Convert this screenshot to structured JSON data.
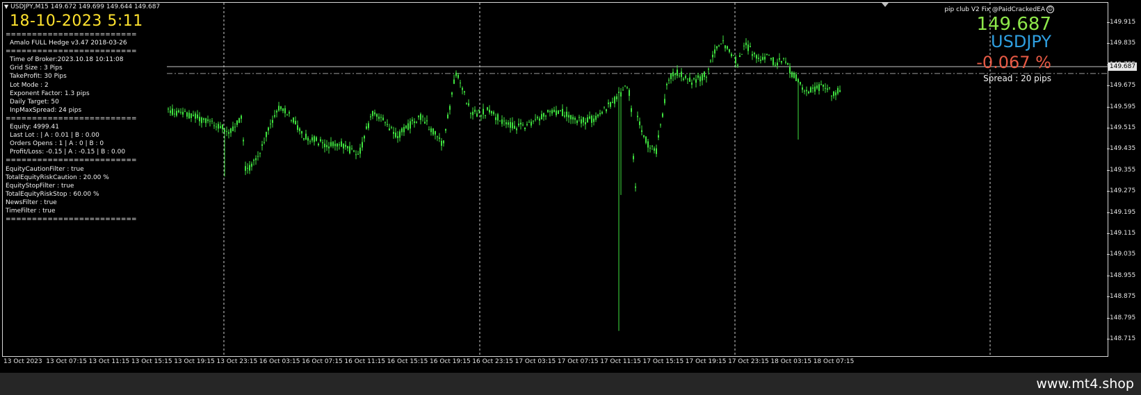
{
  "window": {
    "symbol_timeframe": "USDJPY,M15",
    "ohlc": "149.672 149.699 149.644 149.687",
    "header_text": "USDJPY,M15  149.672 149.699 149.644 149.687"
  },
  "overlay": {
    "big_date": "18-10-2023 5:11",
    "brand": "pip club V2 Fix @PaidCrackedEA",
    "live_price": "149.687",
    "symbol": "USDJPY",
    "change": "-0.067 %",
    "spread": "Spread : 20 pips"
  },
  "info_panel": [
    {
      "text": "=========================",
      "indent": false
    },
    {
      "text": "Amalo FULL Hedge v3.47 2018-03-26",
      "indent": true
    },
    {
      "text": "=========================",
      "indent": false
    },
    {
      "text": "Time of Broker:2023.10.18 10:11:08",
      "indent": true
    },
    {
      "text": "Grid Size : 3 Pips",
      "indent": true
    },
    {
      "text": "TakeProfit: 30 Pips",
      "indent": true
    },
    {
      "text": "Lot Mode : 2",
      "indent": true
    },
    {
      "text": "Exponent Factor: 1.3 pips",
      "indent": true
    },
    {
      "text": "Daily Target: 50",
      "indent": true
    },
    {
      "text": "InpMaxSpread: 24 pips",
      "indent": true
    },
    {
      "text": "=========================",
      "indent": false
    },
    {
      "text": "Equity:      4999.41",
      "indent": true
    },
    {
      "text": "Last Lot : | A : 0.01 | B : 0.00",
      "indent": true
    },
    {
      "text": "Orders Opens :   1 | A : 0 | B : 0",
      "indent": true
    },
    {
      "text": "Profit/Loss: -0.15 | A : -0.15 | B : 0.00",
      "indent": true
    },
    {
      "text": "=========================",
      "indent": false
    },
    {
      "text": "EquityCautionFilter : true",
      "indent": false
    },
    {
      "text": "TotalEquityRiskCaution : 20.00 %",
      "indent": false
    },
    {
      "text": "EquityStopFilter : true",
      "indent": false
    },
    {
      "text": "TotalEquityRiskStop : 60.00 %",
      "indent": false
    },
    {
      "text": "NewsFilter : true",
      "indent": false
    },
    {
      "text": "TimeFilter : true",
      "indent": false
    },
    {
      "text": "=========================",
      "indent": false
    }
  ],
  "current_price_tag": "149.687",
  "watermark": "www.mt4.shop",
  "colors": {
    "candles": "#3fe23f",
    "background": "#000000",
    "grid_dashed": "#d0d0d0",
    "price_line": "#c8c8c8",
    "date_text": "#ffe22e",
    "price_text": "#8ee84a",
    "symbol_text": "#2f9fe0",
    "change_text": "#e75a45"
  },
  "chart_data": {
    "type": "candlestick",
    "symbol": "USDJPY",
    "timeframe": "M15",
    "y_ticks": [
      "149.915",
      "149.835",
      "149.755",
      "149.675",
      "149.595",
      "149.515",
      "149.435",
      "149.355",
      "149.275",
      "149.195",
      "149.115",
      "149.035",
      "148.955",
      "148.875",
      "148.795",
      "148.715"
    ],
    "x_ticks": [
      "13 Oct 2023",
      "13 Oct 07:15",
      "13 Oct 11:15",
      "13 Oct 15:15",
      "13 Oct 19:15",
      "13 Oct 23:15",
      "16 Oct 03:15",
      "16 Oct 07:15",
      "16 Oct 11:15",
      "16 Oct 15:15",
      "16 Oct 19:15",
      "16 Oct 23:15",
      "17 Oct 03:15",
      "17 Oct 07:15",
      "17 Oct 11:15",
      "17 Oct 15:15",
      "17 Oct 19:15",
      "17 Oct 23:15",
      "18 Oct 03:15",
      "18 Oct 07:15"
    ],
    "ylim": [
      148.7,
      149.93
    ],
    "current_price": 149.687,
    "dashdot_level": 149.71,
    "price_path": [
      [
        0.0,
        149.58
      ],
      [
        0.3,
        149.56
      ],
      [
        0.6,
        149.53
      ],
      [
        0.8,
        149.5
      ],
      [
        0.95,
        149.55
      ],
      [
        1.0,
        149.35
      ],
      [
        1.15,
        149.4
      ],
      [
        1.3,
        149.52
      ],
      [
        1.45,
        149.6
      ],
      [
        1.6,
        149.55
      ],
      [
        1.75,
        149.48
      ],
      [
        1.9,
        149.47
      ],
      [
        2.05,
        149.44
      ],
      [
        2.2,
        149.46
      ],
      [
        2.35,
        149.43
      ],
      [
        2.45,
        149.4
      ],
      [
        2.55,
        149.5
      ],
      [
        2.65,
        149.58
      ],
      [
        2.8,
        149.53
      ],
      [
        2.95,
        149.48
      ],
      [
        3.1,
        149.52
      ],
      [
        3.25,
        149.56
      ],
      [
        3.4,
        149.51
      ],
      [
        3.55,
        149.45
      ],
      [
        3.65,
        149.62
      ],
      [
        3.72,
        149.73
      ],
      [
        3.8,
        149.66
      ],
      [
        3.9,
        149.58
      ],
      [
        4.0,
        149.57
      ],
      [
        4.15,
        149.58
      ],
      [
        4.3,
        149.54
      ],
      [
        4.45,
        149.52
      ],
      [
        4.6,
        149.52
      ],
      [
        4.75,
        149.55
      ],
      [
        4.9,
        149.57
      ],
      [
        5.05,
        149.58
      ],
      [
        5.2,
        149.55
      ],
      [
        5.35,
        149.54
      ],
      [
        5.5,
        149.55
      ],
      [
        5.6,
        149.58
      ],
      [
        5.7,
        149.6
      ],
      [
        5.8,
        149.63
      ],
      [
        5.9,
        149.67
      ],
      [
        5.97,
        149.64
      ],
      [
        6.0,
        149.45
      ],
      [
        6.03,
        149.26
      ],
      [
        6.06,
        149.55
      ],
      [
        6.12,
        149.5
      ],
      [
        6.2,
        149.45
      ],
      [
        6.3,
        149.42
      ],
      [
        6.38,
        149.56
      ],
      [
        6.45,
        149.7
      ],
      [
        6.55,
        149.73
      ],
      [
        6.65,
        149.71
      ],
      [
        6.75,
        149.69
      ],
      [
        6.85,
        149.7
      ],
      [
        6.95,
        149.72
      ],
      [
        7.05,
        149.8
      ],
      [
        7.15,
        149.85
      ],
      [
        7.25,
        149.8
      ],
      [
        7.35,
        149.76
      ],
      [
        7.45,
        149.83
      ],
      [
        7.55,
        149.8
      ],
      [
        7.65,
        149.78
      ],
      [
        7.75,
        149.78
      ],
      [
        7.85,
        149.76
      ],
      [
        7.95,
        149.78
      ],
      [
        8.05,
        149.72
      ],
      [
        8.12,
        149.7
      ],
      [
        8.2,
        149.65
      ],
      [
        8.3,
        149.66
      ],
      [
        8.4,
        149.67
      ],
      [
        8.5,
        149.66
      ],
      [
        8.6,
        149.64
      ],
      [
        8.7,
        149.67
      ]
    ]
  }
}
